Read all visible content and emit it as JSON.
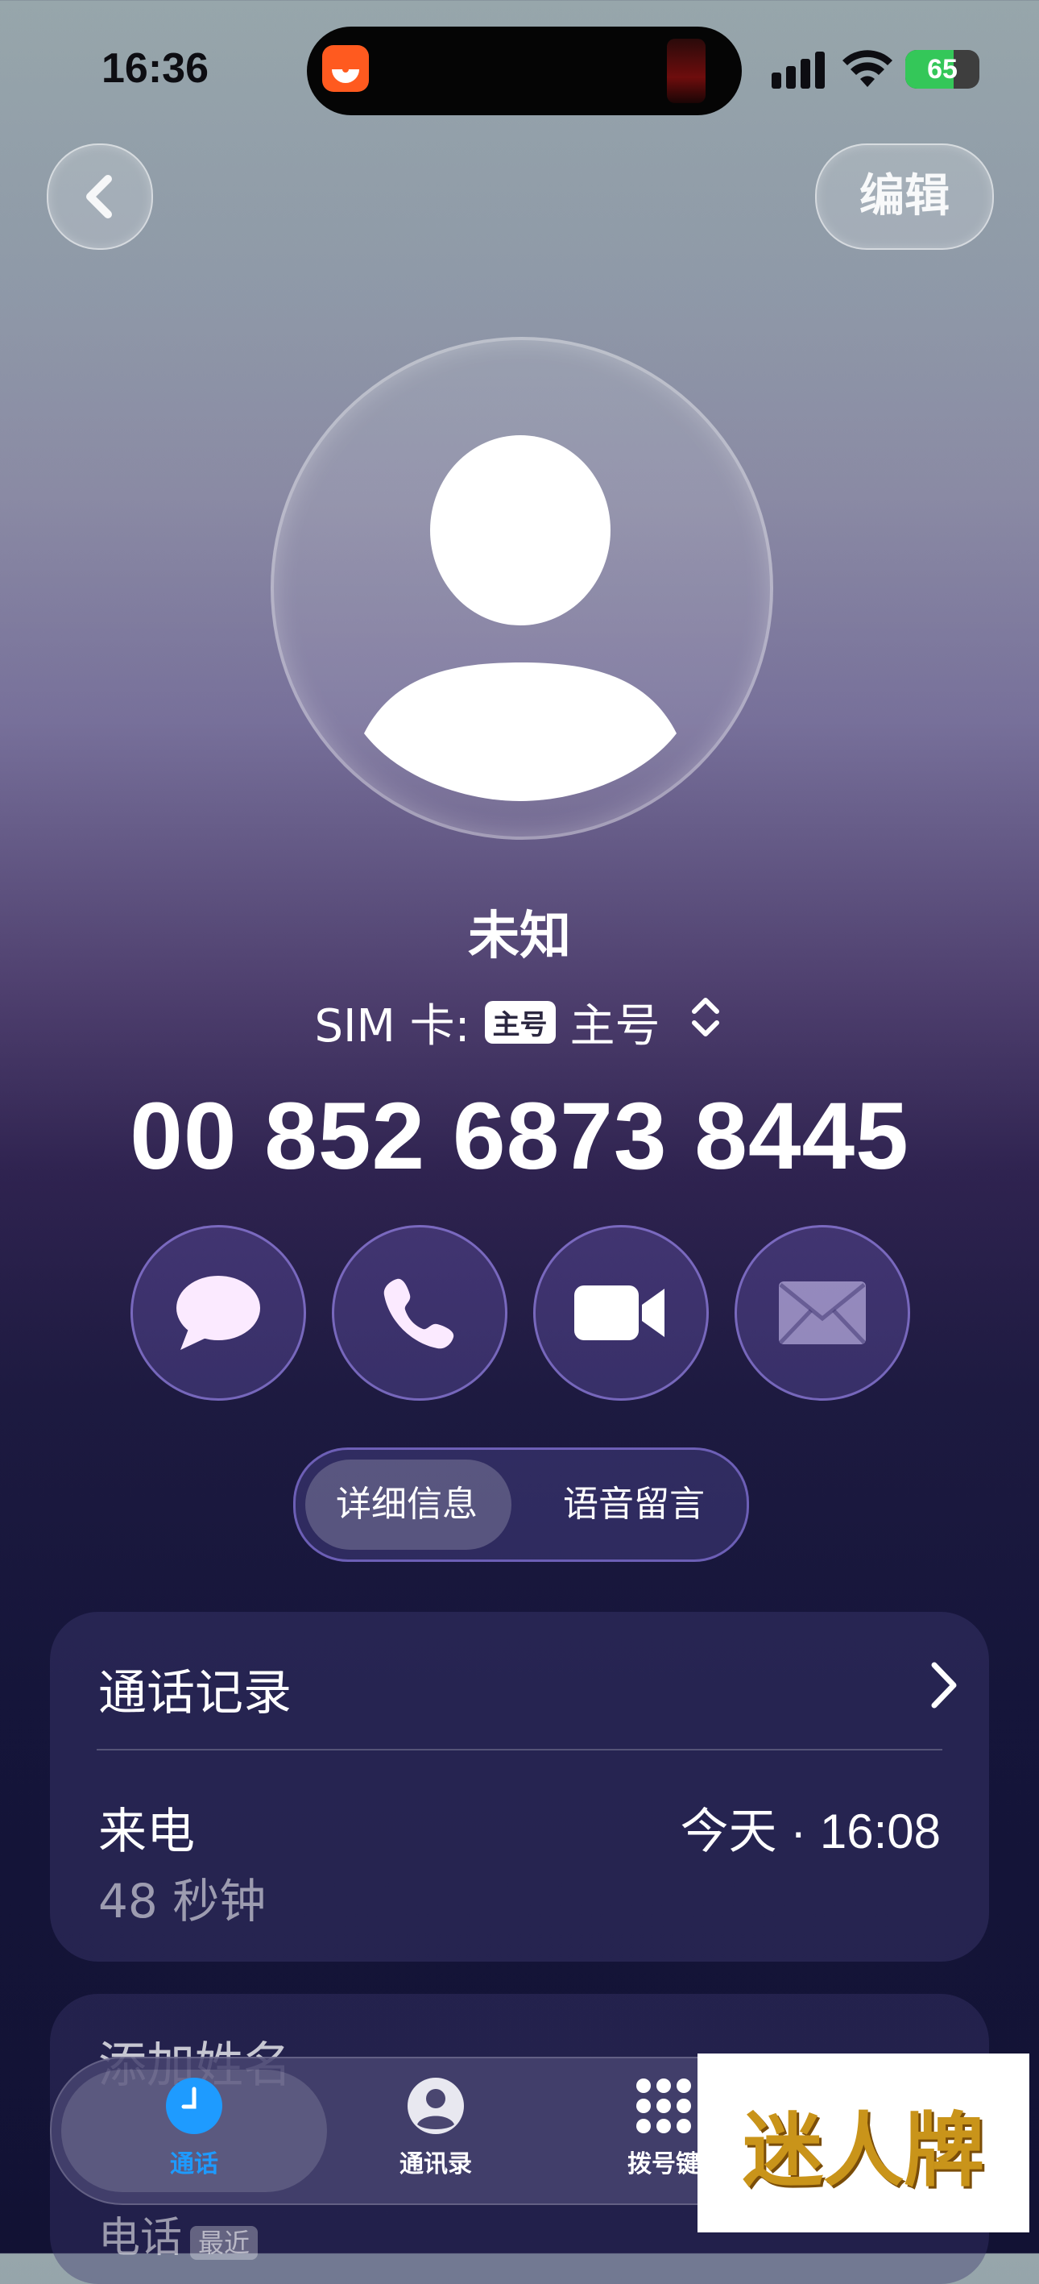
{
  "status_bar": {
    "time": "16:36",
    "battery_level": "65"
  },
  "nav": {
    "edit_label": "编辑"
  },
  "contact": {
    "name": "未知",
    "sim_label": "SIM 卡:",
    "sim_badge": "主号",
    "sim_value": "主号",
    "phone_number": "00 852 6873 8445"
  },
  "actions": [
    {
      "name": "message",
      "icon": "message-bubble-icon"
    },
    {
      "name": "call",
      "icon": "phone-icon"
    },
    {
      "name": "video",
      "icon": "video-camera-icon"
    },
    {
      "name": "mail",
      "icon": "envelope-icon"
    }
  ],
  "segment": {
    "items": [
      "详细信息",
      "语音留言"
    ],
    "selected": "详细信息"
  },
  "call_history": {
    "title": "通话记录",
    "entries": [
      {
        "type": "来电",
        "time": "今天 · 16:08",
        "duration": "48 秒钟"
      }
    ]
  },
  "card2": {
    "title": "添加姓名",
    "sub_label": "电话",
    "sub_badge": "最近"
  },
  "tab_bar": {
    "tabs": [
      {
        "label": "通话",
        "icon": "clock-icon"
      },
      {
        "label": "通讯录",
        "icon": "person-circle-icon"
      },
      {
        "label": "拨号键",
        "icon": "keypad-icon"
      }
    ],
    "active": "通话"
  },
  "watermark": {
    "text": "迷人牌"
  },
  "colors": {
    "accent": "#1e9bff",
    "battery_green": "#34c759"
  }
}
